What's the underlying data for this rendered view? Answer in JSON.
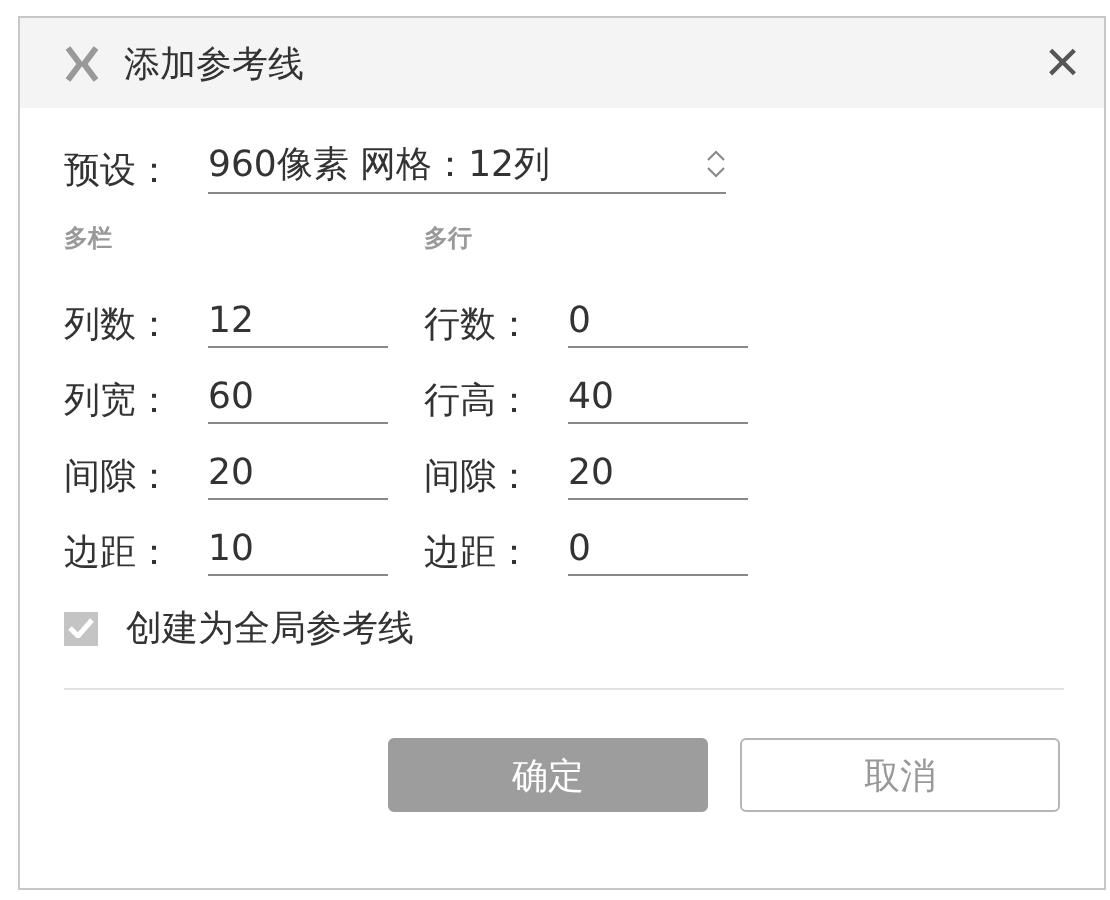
{
  "window": {
    "title": "添加参考线",
    "close": "×"
  },
  "preset": {
    "label": "预设：",
    "value": "960像素 网格：12列"
  },
  "groups": [
    {
      "heading": "多栏",
      "fields": [
        {
          "label": "列数：",
          "value": "12"
        },
        {
          "label": "列宽：",
          "value": "60"
        },
        {
          "label": "间隙：",
          "value": "20"
        },
        {
          "label": "边距：",
          "value": "10"
        }
      ]
    },
    {
      "heading": "多行",
      "fields": [
        {
          "label": "行数：",
          "value": "0"
        },
        {
          "label": "行高：",
          "value": "40"
        },
        {
          "label": "间隙：",
          "value": "20"
        },
        {
          "label": "边距：",
          "value": "0"
        }
      ]
    }
  ],
  "global_option": {
    "label": "创建为全局参考线",
    "checked": true
  },
  "buttons": [
    {
      "label": "确定",
      "kind": "primary"
    },
    {
      "label": "取消",
      "kind": "secondary"
    }
  ]
}
